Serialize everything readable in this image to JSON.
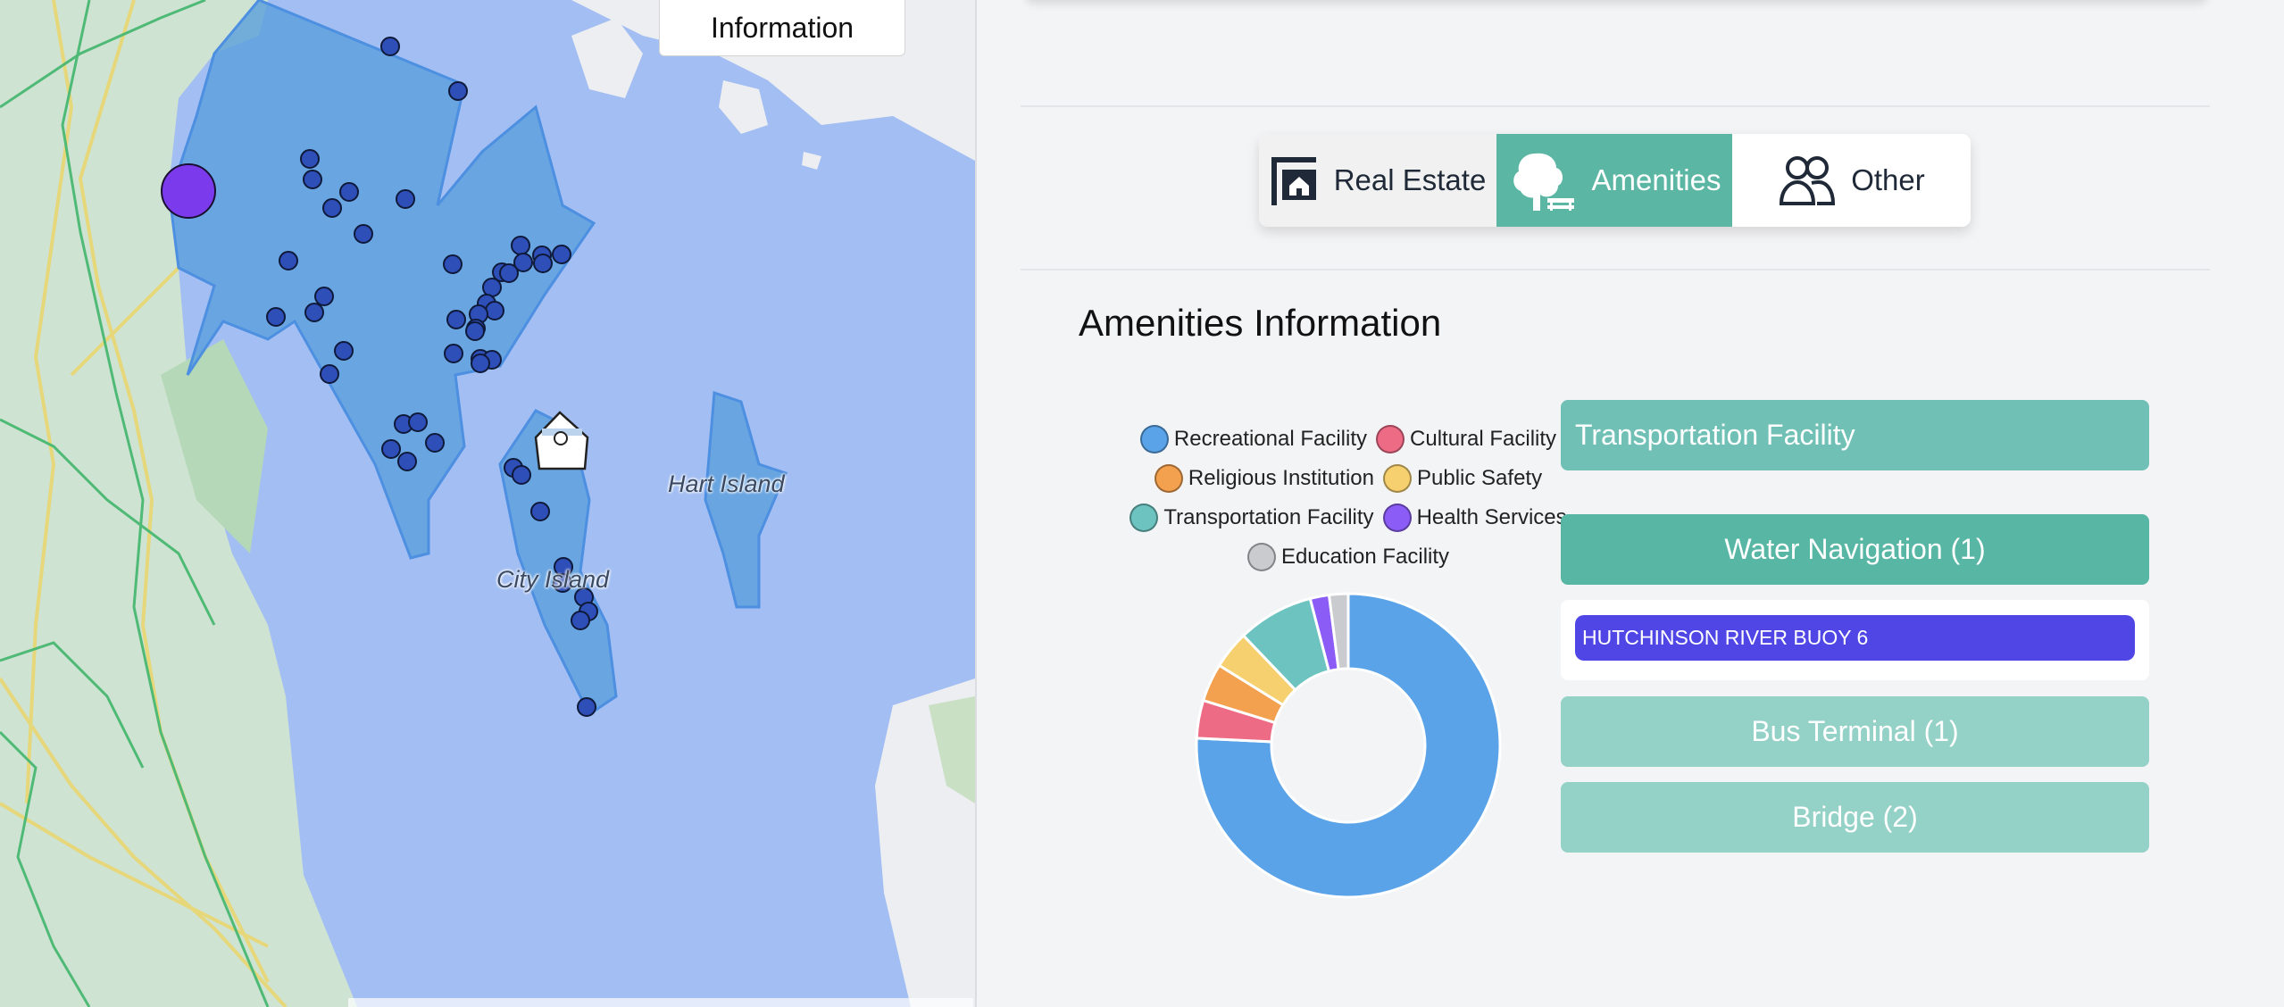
{
  "map": {
    "info_button": "Information",
    "labels": {
      "hart_island": "Hart Island",
      "city_island": "City Island"
    },
    "colors": {
      "water": "#a3bef2",
      "land": "#cfe3d3",
      "district_fill": "#5a9fdc",
      "marker": "#2f4fb8",
      "selected_marker": "#7c3aed"
    }
  },
  "tabs": [
    {
      "label": "Real Estate",
      "icon": "real-estate-sign-icon",
      "active": false
    },
    {
      "label": "Amenities",
      "icon": "tree-bench-icon",
      "active": true
    },
    {
      "label": "Other",
      "icon": "people-icon",
      "active": false
    }
  ],
  "section_title": "Amenities Information",
  "chart_data": {
    "type": "pie",
    "subtype": "doughnut",
    "legend_position": "top",
    "labels": [
      "Recreational Facility",
      "Cultural Facility",
      "Religious Institution",
      "Public Safety",
      "Transportation Facility",
      "Health Services",
      "Education Facility"
    ],
    "colors": [
      "#5aa3e8",
      "#ee6b86",
      "#f3a04f",
      "#f6d06e",
      "#6cc3bf",
      "#8b5cf6",
      "#c9cbcf"
    ],
    "values": [
      75,
      4,
      4,
      4,
      8,
      2,
      2
    ]
  },
  "categories": {
    "transport_header": "Transportation Facility",
    "water_navigation": "Water Navigation (1)",
    "water_items": [
      "HUTCHINSON RIVER BUOY 6"
    ],
    "bus_terminal": "Bus Terminal (1)",
    "bridge": "Bridge (2)"
  }
}
